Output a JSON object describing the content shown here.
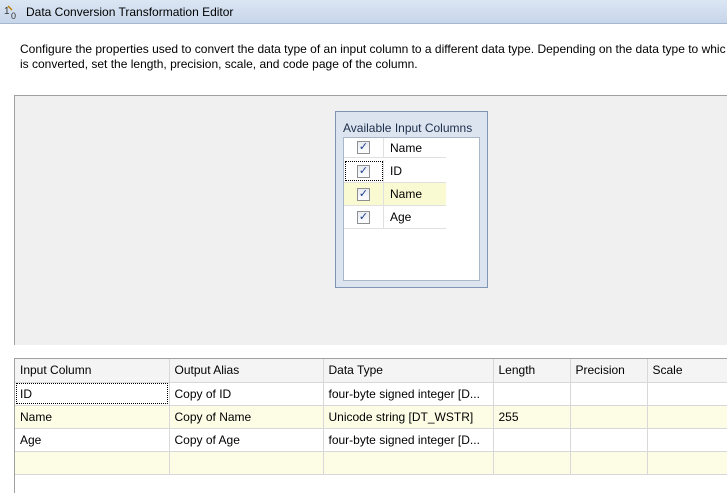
{
  "window": {
    "title": "Data Conversion Transformation Editor",
    "icon": "data-conversion-icon"
  },
  "description": {
    "line1": "Configure the properties used to convert the data type of an input column to a different data type. Depending on the data type to whic",
    "line2": "is converted, set the length, precision, scale, and code page of the column."
  },
  "available_columns": {
    "title": "Available Input Columns",
    "header_label": "Name",
    "header_checked": true,
    "items": [
      {
        "label": "ID",
        "checked": true
      },
      {
        "label": "Name",
        "checked": true
      },
      {
        "label": "Age",
        "checked": true
      }
    ]
  },
  "grid": {
    "columns": [
      "Input Column",
      "Output Alias",
      "Data Type",
      "Length",
      "Precision",
      "Scale"
    ],
    "rows": [
      [
        "ID",
        "Copy of ID",
        "four-byte signed integer [D...",
        "",
        "",
        ""
      ],
      [
        "Name",
        "Copy of Name",
        "Unicode string [DT_WSTR]",
        "255",
        "",
        ""
      ],
      [
        "Age",
        "Copy of Age",
        "four-byte signed integer [D...",
        "",
        "",
        ""
      ],
      [
        "",
        "",
        "",
        "",
        "",
        ""
      ]
    ]
  },
  "colors": {
    "selected_row": "#fafad2",
    "title_bar": "#dbe6f4",
    "check_mark": "#1c3e8a"
  }
}
